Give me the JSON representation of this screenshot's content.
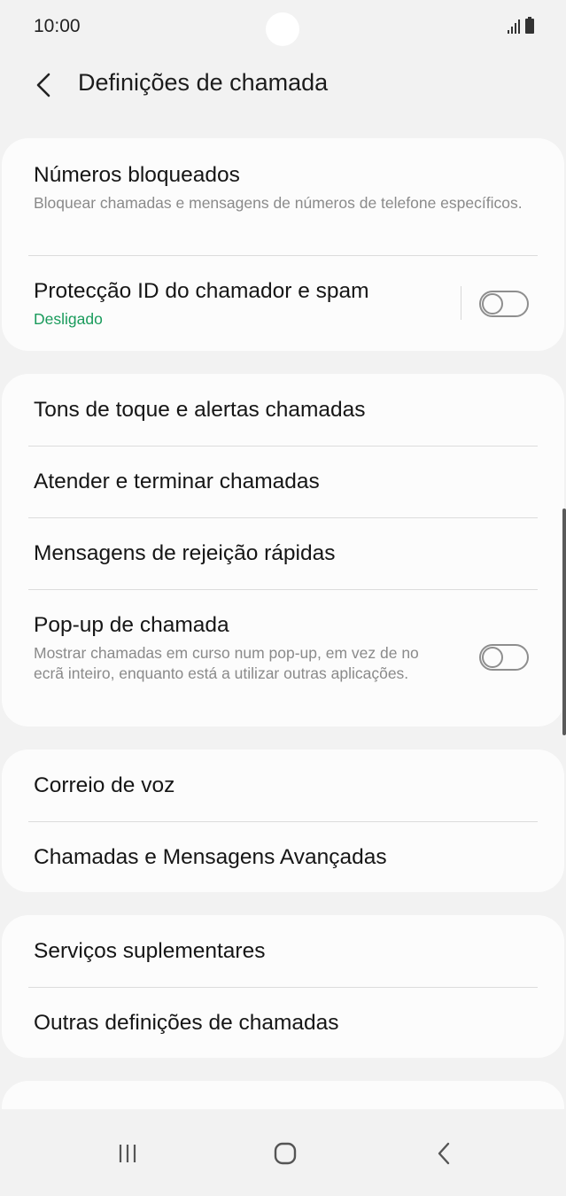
{
  "status_bar": {
    "time": "10:00"
  },
  "header": {
    "title": "Definições de chamada"
  },
  "group1": {
    "blocked": {
      "title": "Números bloqueados",
      "subtitle": "Bloquear chamadas e mensagens de números de telefone específicos."
    },
    "caller_id": {
      "title": "Protecção ID do chamador e spam",
      "status": "Desligado",
      "toggle_on": false
    }
  },
  "group2": {
    "ringtones": {
      "title": "Tons de toque e alertas chamadas"
    },
    "answer_end": {
      "title": "Atender e terminar chamadas"
    },
    "quick_decline": {
      "title": "Mensagens de rejeição rápidas"
    },
    "popup": {
      "title": "Pop-up de chamada",
      "subtitle": "Mostrar chamadas em curso num pop-up, em vez de no ecrã inteiro, enquanto está a utilizar outras aplicações.",
      "toggle_on": false
    }
  },
  "group3": {
    "voicemail": {
      "title": "Correio de voz"
    },
    "advanced": {
      "title": "Chamadas e Mensagens Avançadas"
    }
  },
  "group4": {
    "supplementary": {
      "title": "Serviços suplementares"
    },
    "other": {
      "title": "Outras definições de chamadas"
    }
  },
  "colors": {
    "accent_green": "#1a9b5c",
    "background": "#f2f2f2",
    "card": "#fcfcfc"
  },
  "icons": {
    "back": "chevron-left-icon",
    "recents": "recents-icon",
    "home": "home-icon",
    "nav_back": "nav-back-icon"
  }
}
